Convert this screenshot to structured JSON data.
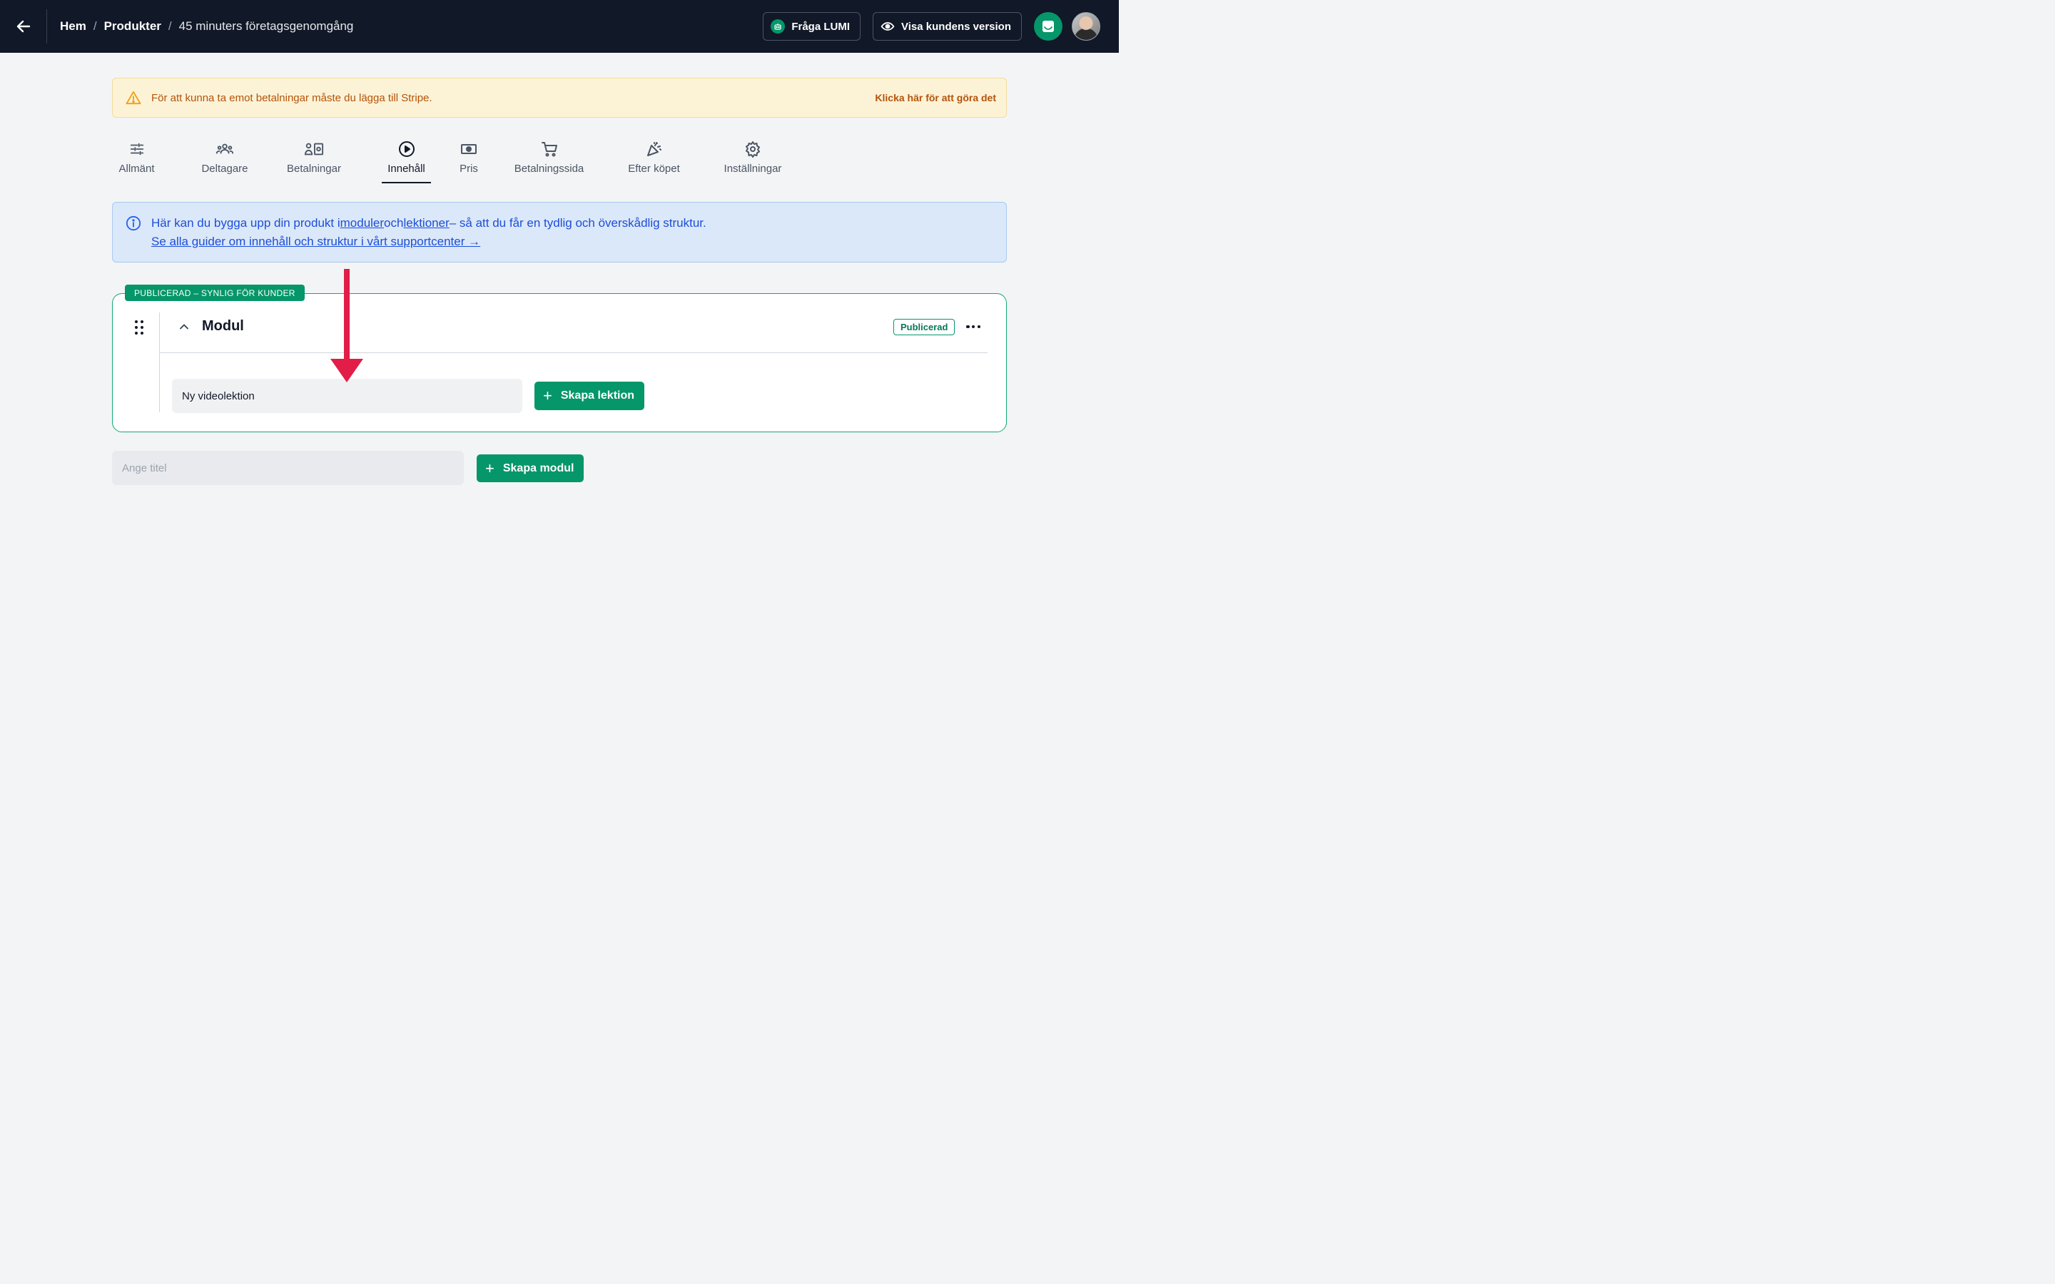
{
  "header": {
    "breadcrumb": [
      "Hem",
      "Produkter",
      "45 minuters företagsgenomgång"
    ],
    "ask_lumi_label": "Fråga LUMI",
    "view_customer_label": "Visa kundens version"
  },
  "warning": {
    "text": "För att kunna ta emot betalningar måste du lägga till Stripe.",
    "link": "Klicka här för att göra det"
  },
  "tabs": [
    {
      "label": "Allmänt",
      "icon": "sliders-icon"
    },
    {
      "label": "Deltagare",
      "icon": "users-icon"
    },
    {
      "label": "Betalningar",
      "icon": "payments-icon"
    },
    {
      "label": "Innehåll",
      "icon": "play-circle-icon",
      "active": true
    },
    {
      "label": "Pris",
      "icon": "cash-icon"
    },
    {
      "label": "Betalningssida",
      "icon": "cart-icon"
    },
    {
      "label": "Efter köpet",
      "icon": "party-icon"
    },
    {
      "label": "Inställningar",
      "icon": "gear-icon"
    }
  ],
  "info": {
    "line1_prefix": "Här kan du bygga upp din produkt i",
    "link_modules": "moduler",
    "and": "och",
    "link_lessons": "lektioner",
    "line1_suffix": "– så att du får en tydlig och överskådlig struktur.",
    "guide_link": "Se alla guider om innehåll och struktur i vårt supportcenter →"
  },
  "module": {
    "published_label": "PUBLICERAD – SYNLIG FÖR KUNDER",
    "title": "Modul",
    "status": "Publicerad",
    "lesson_input_value": "Ny videolektion",
    "create_lesson_label": "Skapa lektion"
  },
  "new_module": {
    "placeholder": "Ange titel",
    "create_label": "Skapa modul"
  },
  "colors": {
    "topbar": "#111827",
    "accent_green": "#059669",
    "annotation_arrow": "#e11d48"
  }
}
